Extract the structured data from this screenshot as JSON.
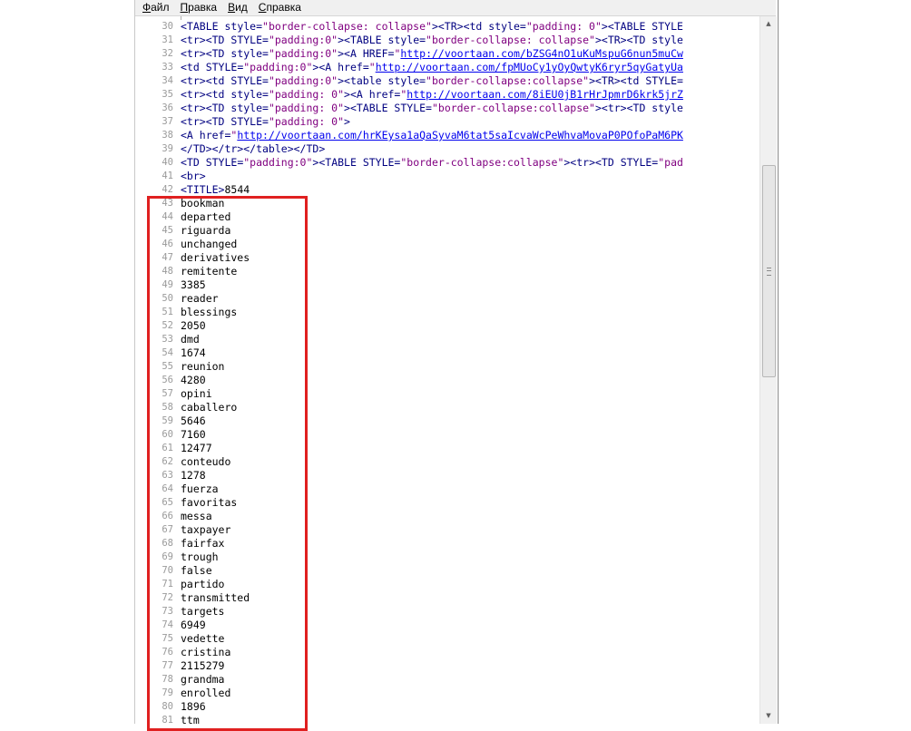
{
  "menubar": {
    "items": [
      {
        "accel": "Ф",
        "rest": "айл"
      },
      {
        "accel": "П",
        "rest": "равка"
      },
      {
        "accel": "В",
        "rest": "ид"
      },
      {
        "accel": "С",
        "rest": "правка"
      }
    ]
  },
  "editor": {
    "html_lines": [
      {
        "n": "30",
        "parts": [
          [
            "t",
            "<TABLE "
          ],
          [
            "kw",
            "style="
          ],
          [
            "s",
            "\"border-collapse: collapse\""
          ],
          [
            "t",
            "><TR><td "
          ],
          [
            "kw",
            "style="
          ],
          [
            "s",
            "\"padding: 0\""
          ],
          [
            "t",
            "><TABLE "
          ],
          [
            "kw",
            "STYLE"
          ]
        ]
      },
      {
        "n": "31",
        "parts": [
          [
            "t",
            "<tr><TD "
          ],
          [
            "kw",
            "STYLE="
          ],
          [
            "s",
            "\"padding:0\""
          ],
          [
            "t",
            "><TABLE "
          ],
          [
            "kw",
            "style="
          ],
          [
            "s",
            "\"border-collapse: collapse\""
          ],
          [
            "t",
            "><TR><TD "
          ],
          [
            "kw",
            "style"
          ]
        ]
      },
      {
        "n": "32",
        "parts": [
          [
            "t",
            "<tr><TD "
          ],
          [
            "kw",
            "style="
          ],
          [
            "s",
            "\"padding:0\""
          ],
          [
            "t",
            "><A "
          ],
          [
            "kw",
            "HREF="
          ],
          [
            "s",
            "\""
          ],
          [
            "u",
            "http://voortaan.com/bZSG4nO1uKuMspuG6nun5muCw"
          ]
        ]
      },
      {
        "n": "33",
        "parts": [
          [
            "t",
            "<td "
          ],
          [
            "kw",
            "STYLE="
          ],
          [
            "s",
            "\"padding:0\""
          ],
          [
            "t",
            "><A "
          ],
          [
            "kw",
            "href="
          ],
          [
            "s",
            "\""
          ],
          [
            "u",
            "http://voortaan.com/fpMUoCy1yOyQwtyK6ryr5qyGatyUa"
          ]
        ]
      },
      {
        "n": "34",
        "parts": [
          [
            "t",
            "<tr><td "
          ],
          [
            "kw",
            "STYLE="
          ],
          [
            "s",
            "\"padding:0\""
          ],
          [
            "t",
            "><table "
          ],
          [
            "kw",
            "style="
          ],
          [
            "s",
            "\"border-collapse:collapse\""
          ],
          [
            "t",
            "><TR><td "
          ],
          [
            "kw",
            "STYLE="
          ]
        ]
      },
      {
        "n": "35",
        "parts": [
          [
            "t",
            "<tr><td "
          ],
          [
            "kw",
            "style="
          ],
          [
            "s",
            "\"padding: 0\""
          ],
          [
            "t",
            "><A "
          ],
          [
            "kw",
            "href="
          ],
          [
            "s",
            "\""
          ],
          [
            "u",
            "http://voortaan.com/8iEU0jB1rHrJpmrD6krk5jrZ"
          ]
        ]
      },
      {
        "n": "36",
        "parts": [
          [
            "t",
            "<tr><TD "
          ],
          [
            "kw",
            "style="
          ],
          [
            "s",
            "\"padding: 0\""
          ],
          [
            "t",
            "><TABLE "
          ],
          [
            "kw",
            "STYLE="
          ],
          [
            "s",
            "\"border-collapse:collapse\""
          ],
          [
            "t",
            "><tr><TD "
          ],
          [
            "kw",
            "style"
          ]
        ]
      },
      {
        "n": "37",
        "parts": [
          [
            "t",
            "<tr><TD "
          ],
          [
            "kw",
            "STYLE="
          ],
          [
            "s",
            "\"padding: 0\""
          ],
          [
            "t",
            ">"
          ]
        ]
      },
      {
        "n": "38",
        "parts": [
          [
            "t",
            "<A "
          ],
          [
            "kw",
            "href="
          ],
          [
            "s",
            "\""
          ],
          [
            "u",
            "http://voortaan.com/hrKEysa1aQaSyvaM6tat5saIcvaWcPeWhvaMovaP0POfoPaM6PK"
          ]
        ]
      },
      {
        "n": "39",
        "parts": [
          [
            "t",
            "</TD></tr></table></TD>"
          ]
        ]
      },
      {
        "n": "40",
        "parts": [
          [
            "t",
            "<TD "
          ],
          [
            "kw",
            "STYLE="
          ],
          [
            "s",
            "\"padding:0\""
          ],
          [
            "t",
            "><TABLE "
          ],
          [
            "kw",
            "STYLE="
          ],
          [
            "s",
            "\"border-collapse:collapse\""
          ],
          [
            "t",
            "><tr><TD "
          ],
          [
            "kw",
            "STYLE="
          ],
          [
            "s",
            "\"pad"
          ]
        ]
      },
      {
        "n": "41",
        "parts": [
          [
            "t",
            "<br>"
          ]
        ]
      },
      {
        "n": "42",
        "parts": [
          [
            "t",
            "<TITLE>"
          ],
          [
            "p",
            "8544"
          ]
        ]
      }
    ],
    "word_lines": [
      {
        "n": "43",
        "text": "bookman"
      },
      {
        "n": "44",
        "text": "departed"
      },
      {
        "n": "45",
        "text": "riguarda"
      },
      {
        "n": "46",
        "text": "unchanged"
      },
      {
        "n": "47",
        "text": "derivatives"
      },
      {
        "n": "48",
        "text": "remitente"
      },
      {
        "n": "49",
        "text": "3385"
      },
      {
        "n": "50",
        "text": "reader"
      },
      {
        "n": "51",
        "text": "blessings"
      },
      {
        "n": "52",
        "text": "2050"
      },
      {
        "n": "53",
        "text": "dmd"
      },
      {
        "n": "54",
        "text": "1674"
      },
      {
        "n": "55",
        "text": "reunion"
      },
      {
        "n": "56",
        "text": "4280"
      },
      {
        "n": "57",
        "text": "opini"
      },
      {
        "n": "58",
        "text": "caballero"
      },
      {
        "n": "59",
        "text": "5646"
      },
      {
        "n": "60",
        "text": "7160"
      },
      {
        "n": "61",
        "text": "12477"
      },
      {
        "n": "62",
        "text": "conteudo"
      },
      {
        "n": "63",
        "text": "1278"
      },
      {
        "n": "64",
        "text": "fuerza"
      },
      {
        "n": "65",
        "text": "favoritas"
      },
      {
        "n": "66",
        "text": "messa"
      },
      {
        "n": "67",
        "text": "taxpayer"
      },
      {
        "n": "68",
        "text": "fairfax"
      },
      {
        "n": "69",
        "text": "trough"
      },
      {
        "n": "70",
        "text": "false"
      },
      {
        "n": "71",
        "text": "partido"
      },
      {
        "n": "72",
        "text": "transmitted"
      },
      {
        "n": "73",
        "text": "targets"
      },
      {
        "n": "74",
        "text": "6949"
      },
      {
        "n": "75",
        "text": "vedette"
      },
      {
        "n": "76",
        "text": "cristina"
      },
      {
        "n": "77",
        "text": "2115279"
      },
      {
        "n": "78",
        "text": "grandma"
      },
      {
        "n": "79",
        "text": "enrolled"
      },
      {
        "n": "80",
        "text": "1896"
      },
      {
        "n": "81",
        "text": "ttm"
      }
    ]
  },
  "scrollbar": {
    "up_arrow_icon": "triangle-up",
    "down_arrow_icon": "triangle-down"
  },
  "annotation": {
    "color": "#e02020"
  }
}
